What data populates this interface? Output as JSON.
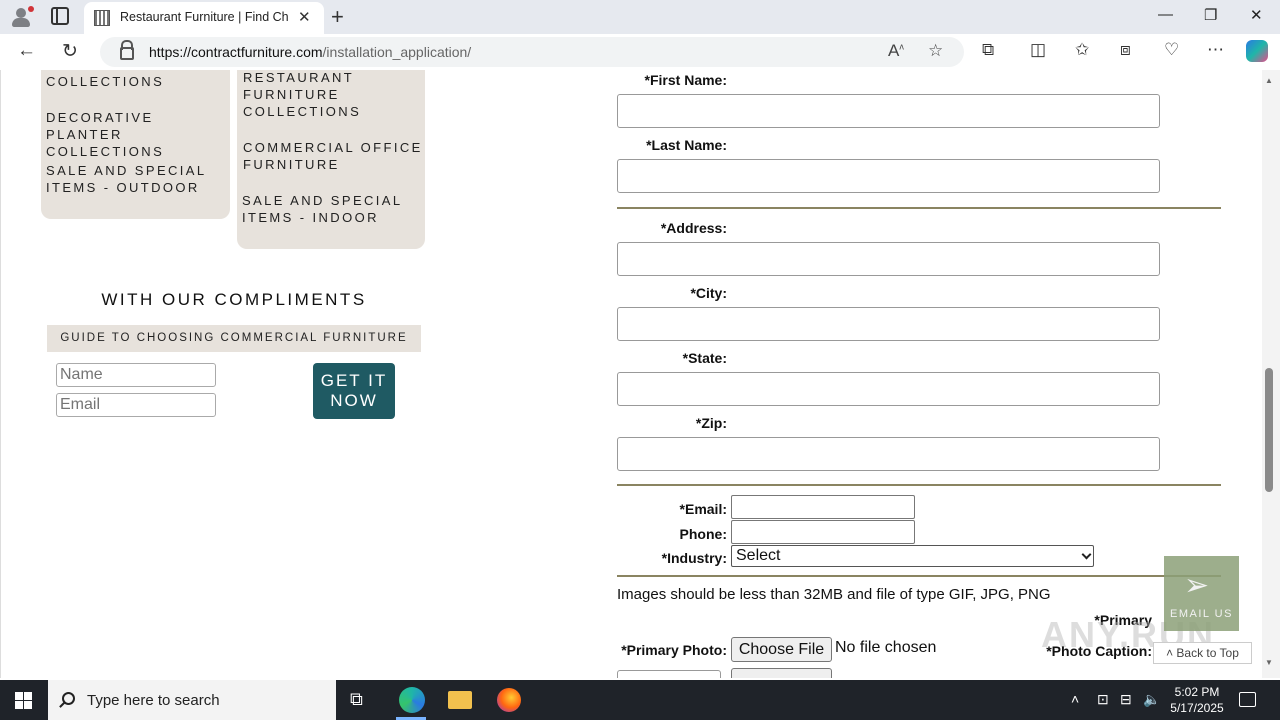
{
  "browser": {
    "tab_title": "Restaurant Furniture | Find Chairs",
    "url_host": "https://contractfurniture.com",
    "url_path": "/installation_application/"
  },
  "sidebar": {
    "left_menu": [
      "COLLECTIONS",
      "DECORATIVE PLANTER COLLECTIONS",
      "SALE AND SPECIAL ITEMS - OUTDOOR"
    ],
    "right_menu": [
      "RESTAURANT FURNITURE COLLECTIONS",
      "COMMERCIAL OFFICE FURNITURE",
      "SALE AND SPECIAL ITEMS - INDOOR"
    ],
    "compliments_title": "WITH OUR COMPLIMENTS",
    "guide_title": "GUIDE TO CHOOSING COMMERCIAL FURNITURE",
    "name_placeholder": "Name",
    "email_placeholder": "Email",
    "cta_label": "GET IT NOW"
  },
  "form": {
    "first_name": "*First Name:",
    "last_name": "*Last Name:",
    "address": "*Address:",
    "city": "*City:",
    "state": "*State:",
    "zip": "*Zip:",
    "email": "*Email:",
    "phone": "Phone:",
    "industry": "*Industry:",
    "industry_selected": "Select",
    "images_note": "Images should be less than 32MB and file of type GIF, JPG, PNG",
    "primary_photo": "*Primary Photo:",
    "primary": "*Primary",
    "photo_caption": "*Photo Caption:",
    "choose_file": "Choose File",
    "no_file": "No file chosen"
  },
  "floating": {
    "email_us": "EMAIL US",
    "back_to_top": "Back to Top",
    "watermark": "ANY.RUN"
  },
  "taskbar": {
    "search_placeholder": "Type here to search",
    "time": "5:02 PM",
    "date": "5/17/2025"
  }
}
